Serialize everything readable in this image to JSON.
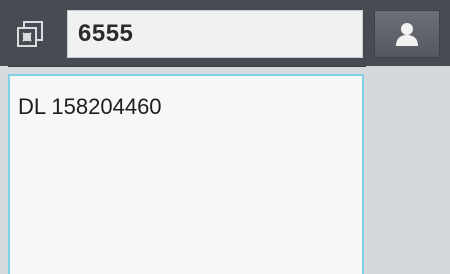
{
  "header": {
    "collapse_icon": "collapse-arrows-icon",
    "recipient": "6555",
    "contact_icon": "person-icon"
  },
  "message": {
    "text": "DL 158204460"
  },
  "colors": {
    "header_bg": "#474b52",
    "focus_border": "#7fd1e3"
  }
}
